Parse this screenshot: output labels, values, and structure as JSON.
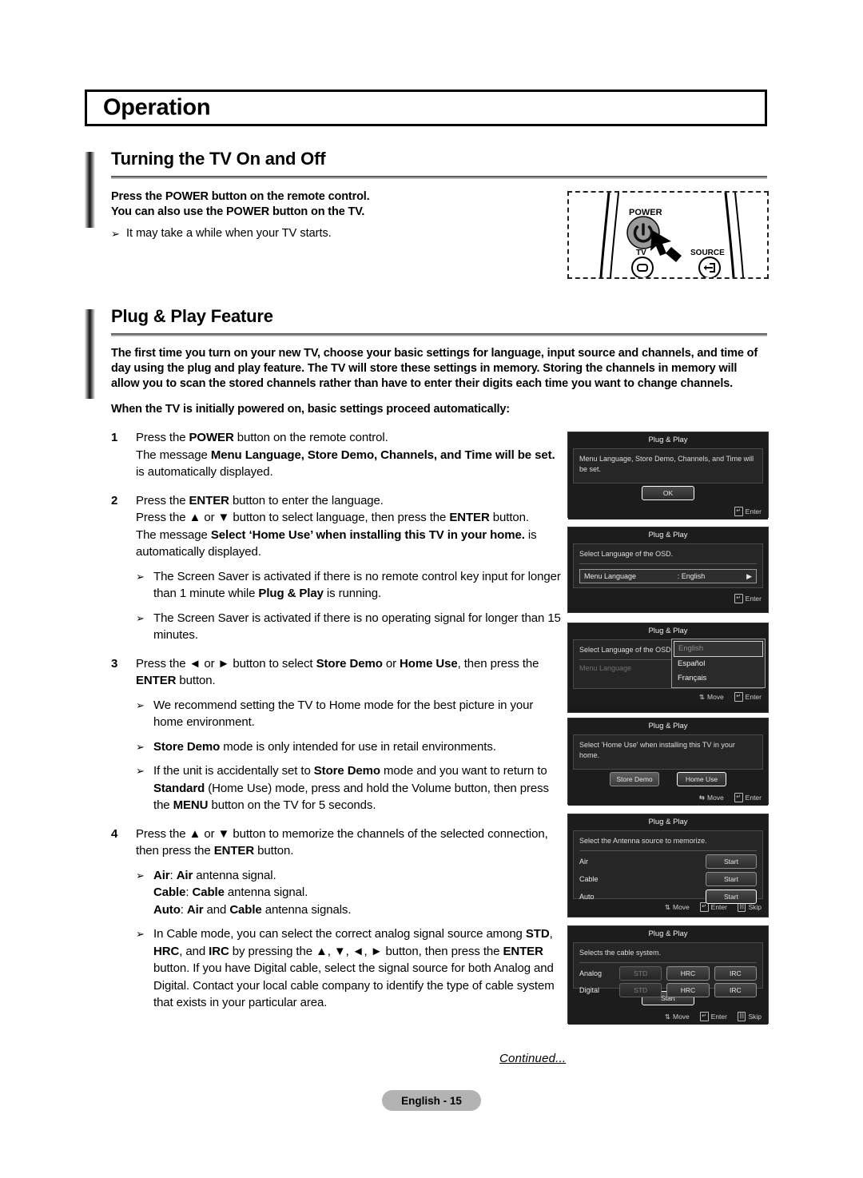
{
  "chapter": {
    "title": "Operation"
  },
  "sections": [
    {
      "id": "turning",
      "title": "Turning the TV On and Off",
      "bold_intro_line1": "Press the POWER button on the remote control.",
      "bold_intro_line2": "You can also use the POWER button on the TV.",
      "tip": "It may take a while when your TV starts.",
      "bullet_glyph": "➢"
    },
    {
      "id": "plugplay",
      "title": "Plug & Play Feature",
      "bold_paragraph": "The first time you turn on your new TV, choose your basic settings for language, input source and channels, and time of day using the plug and play feature. The TV will store these settings in memory. Storing the channels in memory will allow you to scan the stored channels rather than have to enter their digits each time you want to change channels.",
      "bold_paragraph2": "When the TV is initially powered on, basic settings proceed automatically:"
    }
  ],
  "remote": {
    "power_label": "POWER",
    "tv_label": "TV",
    "source_label": "SOURCE"
  },
  "steps": [
    {
      "num": "1",
      "lines": [
        "Press the <b>POWER</b> button on the remote control.",
        "The message <b>Menu Language, Store Demo, Channels, and Time will be set.</b> is automatically displayed."
      ],
      "subs": []
    },
    {
      "num": "2",
      "lines": [
        "Press the <b>ENTER</b> button to enter the language.",
        "Press the ▲ or ▼ button to select language, then press the <b>ENTER</b> button.",
        "The message <b>Select ‘Home Use’ when installing this TV in your home.</b> is automatically displayed."
      ],
      "subs": [
        "The Screen Saver is activated if there is no remote control key input for longer than 1 minute while <b>Plug &amp; Play</b> is running.",
        "The Screen Saver is activated if there is no operating signal for longer than 15 minutes."
      ]
    },
    {
      "num": "3",
      "lines": [
        "Press the ◄ or ► button to select <b>Store Demo</b> or <b>Home Use</b>, then press the <b>ENTER</b> button."
      ],
      "subs": [
        "We recommend setting the TV to Home mode for the best picture in your home environment.",
        "<b>Store Demo</b> mode is only intended for use in retail environments.",
        "If the unit is accidentally set to <b>Store Demo</b> mode and you want to return to <b>Standard</b> (Home Use) mode, press and hold the Volume button, then press the <b>MENU</b> button on the TV for 5 seconds."
      ]
    },
    {
      "num": "4",
      "lines": [
        "Press the ▲ or ▼ button to memorize the channels of the selected connection, then press the <b>ENTER</b> button."
      ],
      "subs": [
        "<b>Air</b>: <b>Air</b> antenna signal.<br><b>Cable</b>: <b>Cable</b> antenna signal.<br><b>Auto</b>: <b>Air</b> and <b>Cable</b> antenna signals.",
        "In Cable mode, you can select the correct analog signal source among <b>STD</b>, <b>HRC</b>, and <b>IRC</b> by pressing the ▲, ▼, ◄, ► button, then press the <b>ENTER</b> button. If you have Digital cable, select the signal source for both Analog and Digital. Contact your local cable company to identify the type of cable system that exists in your particular area."
      ]
    }
  ],
  "osd": {
    "title": "Plug & Play",
    "hints": {
      "move": "Move",
      "enter": "Enter",
      "skip": "Skip"
    },
    "panel1": {
      "message": "Menu Language, Store Demo, Channels, and Time will be set.",
      "ok_label": "OK"
    },
    "panel2": {
      "message": "Select Language of the OSD.",
      "field_label": "Menu Language",
      "field_value": ": English",
      "arrow": "▶"
    },
    "panel3": {
      "message": "Select Language of the OSD.",
      "field_label": "Menu Language",
      "field_colon": ":",
      "options": [
        "English",
        "Español",
        "Français"
      ],
      "selected": "English"
    },
    "panel4": {
      "message": "Select 'Home Use' when installing this TV in your home.",
      "store_demo": "Store Demo",
      "home_use": "Home Use"
    },
    "panel5": {
      "message": "Select the Antenna source to memorize.",
      "rows": [
        {
          "label": "Air",
          "button": "Start",
          "selected": false
        },
        {
          "label": "Cable",
          "button": "Start",
          "selected": false
        },
        {
          "label": "Auto",
          "button": "Start",
          "selected": true
        }
      ]
    },
    "panel6": {
      "message": "Selects the cable system.",
      "rows": [
        {
          "label": "Analog",
          "buttons": [
            "STD",
            "HRC",
            "IRC"
          ]
        },
        {
          "label": "Digital",
          "buttons": [
            "STD",
            "HRC",
            "IRC"
          ]
        }
      ],
      "start_label": "Start"
    }
  },
  "footer": {
    "continued": "Continued...",
    "page": "English - 15"
  }
}
